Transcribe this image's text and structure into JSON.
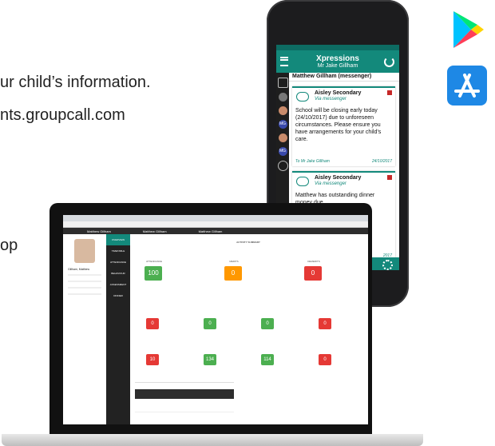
{
  "background_text": {
    "line1": "ur child’s information.",
    "line2": "nts.groupcall.com",
    "line3": "op"
  },
  "store_icons": [
    "google-play-icon",
    "app-store-icon"
  ],
  "phone": {
    "app_title": "Xpressions",
    "app_subtitle": "Mr Jake Gillham",
    "conversation_header": "Matthew Gillham (messenger)",
    "messages": [
      {
        "from": "Aisley Secondary",
        "via": "Via messenger",
        "body": "School will be closing early today (24/10/2017) due to unforeseen circumstances. Please ensure you have arrangements for your child’s care.",
        "to": "To Mr Jake Gillham",
        "date": "24/10/2017"
      },
      {
        "from": "Aisley Secondary",
        "via": "Via messenger",
        "body": "Matthew has outstanding dinner money due",
        "date": "2017"
      }
    ],
    "side_badges": [
      "MG",
      "MG"
    ],
    "accent": "#13897b"
  },
  "laptop": {
    "child_tabs": [
      "Matthew Gillham",
      "Matthew Gillham",
      "Matthew Gillham"
    ],
    "nav_items": [
      "OVERVIEW",
      "TIMETABLE",
      "ATTENDANCE",
      "BEHAVIOUR",
      "ASSESSMENT",
      "DINNER"
    ],
    "activity_title": "ACTIVITY SUMMARY",
    "summary": [
      {
        "label": "ATTENDANCE",
        "value": "100",
        "color": "#4caf50"
      },
      {
        "label": "MERITS",
        "value": "0",
        "color": "#ff9800"
      },
      {
        "label": "DEMERITS",
        "value": "0",
        "color": "#e53935"
      }
    ],
    "row2": [
      {
        "value": "0",
        "color": "#e53935"
      },
      {
        "value": "0",
        "color": "#4caf50"
      },
      {
        "value": "0",
        "color": "#4caf50"
      },
      {
        "value": "0",
        "color": "#e53935"
      }
    ],
    "row3": [
      {
        "value": "10",
        "color": "#e53935"
      },
      {
        "value": "134",
        "color": "#4caf50"
      },
      {
        "value": "114",
        "color": "#4caf50"
      },
      {
        "value": "0",
        "color": "#e53935"
      }
    ],
    "profile": {
      "name": "Gillham, Matthew"
    }
  }
}
